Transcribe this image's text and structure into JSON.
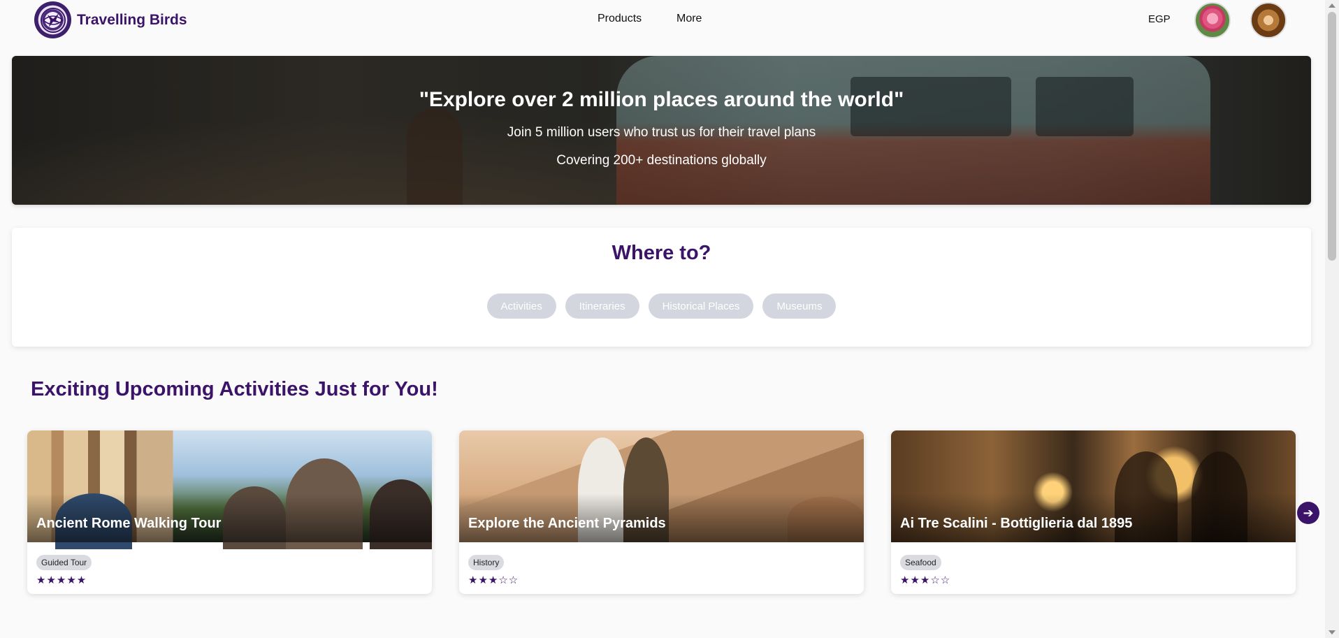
{
  "navbar": {
    "brand": "Travelling Birds",
    "links": [
      "Products",
      "More"
    ],
    "currency": "EGP",
    "logo_icon": "bird-globe-logo",
    "avatars": [
      "rose-avatar",
      "bird-avatar"
    ]
  },
  "hero": {
    "title": "\"Explore over 2 million places around the world\"",
    "subtitle1": "Join 5 million users who trust us for their travel plans",
    "subtitle2": "Covering 200+ destinations globally"
  },
  "where_to": {
    "title": "Where to?",
    "chips": [
      "Activities",
      "Itineraries",
      "Historical Places",
      "Museums"
    ]
  },
  "activities": {
    "title": "Exciting Upcoming Activities Just for You!",
    "cards": [
      {
        "title": "Ancient Rome Walking Tour",
        "tag": "Guided Tour",
        "stars": "★★★★★",
        "rating": 5
      },
      {
        "title": "Explore the Ancient Pyramids",
        "tag": "History",
        "stars": "★★★☆☆",
        "rating": 3
      },
      {
        "title": "Ai Tre Scalini - Bottiglieria dal 1895",
        "tag": "Seafood",
        "stars": "★★★☆☆",
        "rating": 3
      }
    ],
    "next_icon": "arrow-right-icon"
  },
  "colors": {
    "brand": "#3b1369",
    "chip_bg": "#d3d6de"
  }
}
